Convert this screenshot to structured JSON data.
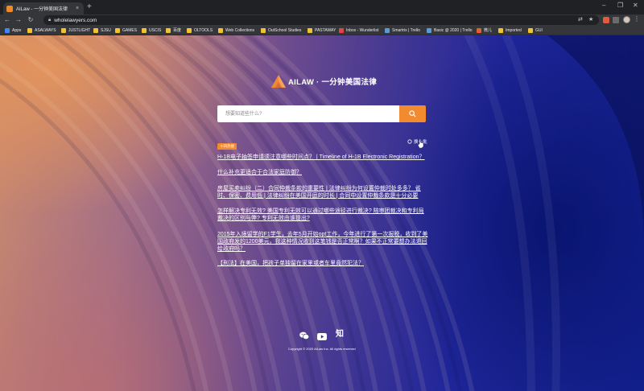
{
  "tab": {
    "title": "AILaw - 一分钟美国法律",
    "close": "×",
    "new_tab": "+"
  },
  "window_controls": {
    "minimize": "–",
    "maximize": "❐",
    "close": "✕"
  },
  "toolbar": {
    "back": "←",
    "forward": "→",
    "reload": "↻",
    "url": "wholelawyers.com"
  },
  "bookmarks": [
    {
      "label": "Apps",
      "icon": "apps-icon",
      "color": "#4285f4"
    },
    {
      "label": "ASALWAYS",
      "icon": "folder-icon",
      "color": "#f1c232"
    },
    {
      "label": "JUSTLIGHT",
      "icon": "folder-icon",
      "color": "#f1c232"
    },
    {
      "label": "SJSU",
      "icon": "folder-icon",
      "color": "#f1c232"
    },
    {
      "label": "GAMES",
      "icon": "folder-icon",
      "color": "#f1c232"
    },
    {
      "label": "USCIS",
      "icon": "folder-icon",
      "color": "#f1c232"
    },
    {
      "label": "百度",
      "icon": "folder-icon",
      "color": "#f1c232"
    },
    {
      "label": "OLTOOLS",
      "icon": "folder-icon",
      "color": "#f1c232"
    },
    {
      "label": "Web Collections",
      "icon": "folder-icon",
      "color": "#f1c232"
    },
    {
      "label": "OutSchool Studies",
      "icon": "folder-icon",
      "color": "#f1c232"
    },
    {
      "label": "PASTAWAY",
      "icon": "folder-icon",
      "color": "#f1c232"
    },
    {
      "label": "Inbox - Wunderlist",
      "icon": "wunderlist-icon",
      "color": "#e04646"
    },
    {
      "label": "Smartrix | Trello",
      "icon": "trello-icon",
      "color": "#5a9bd5"
    },
    {
      "label": "Basic @ 2020 | Trello",
      "icon": "trello-icon",
      "color": "#5a9bd5"
    },
    {
      "label": "微儿",
      "icon": "weier-icon",
      "color": "#e06030"
    },
    {
      "label": "Imported",
      "icon": "folder-icon",
      "color": "#f1c232"
    },
    {
      "label": "GUI",
      "icon": "folder-icon",
      "color": "#f1c232"
    }
  ],
  "page": {
    "logo_text": "AILAW · 一分钟美国法律",
    "search_placeholder": "想要知道些什么?",
    "badge": "十四热搜",
    "refresh": "换一批",
    "questions": [
      "H-1B电子抽签申请须注意哪些时间点？ | Timeline of H-1B Electronic Registration？",
      "什么补充更适合于合法家庭防御？",
      "房屋买卖纠纷（二）合同仲裁条款的重要性 | 法律纠纷为何设置仲裁时处多多？ 省时、保密、费用低 | 法律纠纷在美国开庭的时长 | 合同中设置仲裁条款是十分必要",
      "怎样解决专利无效? 美国专利无效可以通过哪些途径进行裁决? 陪审团裁决和专利局裁决的区别与弊? 专利无效由谁提出?",
      "2015年入境留学的F1学生，去年5月开始opt工作，今年进行了第一次报税，收到了美国政府发的1200美元，我这种情况收到这笔钱是否正常啊？如果不正常要想办法退回给政府吗？",
      "【刑法】在美国，把孩子单独留在家里或者车里竟然犯法？"
    ],
    "copyright": "Copyright © 2020 AILaw Inc. All rights reserved",
    "social": {
      "zhihu": "知"
    }
  },
  "colors": {
    "accent": "#f28b30",
    "page_blue": "#12208e",
    "page_peach": "#cc8a6c"
  }
}
